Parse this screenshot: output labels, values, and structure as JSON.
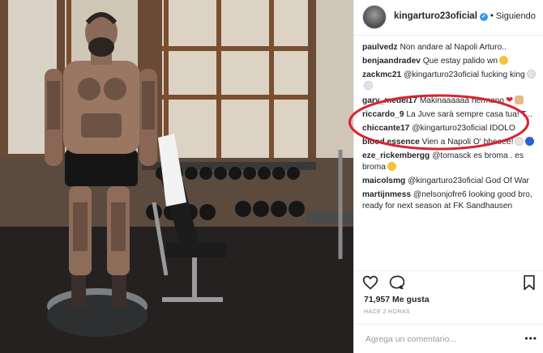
{
  "post": {
    "username": "kingarturo23oficial",
    "separator": "•",
    "follow_state": "Siguiendo",
    "likes": "71,957 Me gusta",
    "time_ago": "HACE 2 HORAS",
    "comment_placeholder": "Agrega un comentario...",
    "more_label": "•••"
  },
  "comments": [
    {
      "user": "paulvedz",
      "text": "Non andare al Napoli Arturo..",
      "emoji": []
    },
    {
      "user": "benjaandradev",
      "text": "Que estay palido wn",
      "emoji": [
        "laugh"
      ]
    },
    {
      "user": "zackmc21",
      "text": "@kingarturo23oficial fucking king",
      "emoji": [
        "white",
        "white"
      ]
    },
    {
      "user": "gary_medel17",
      "text": "Makinaaaaaa hermano",
      "emoji": [
        "heart",
        "muscle"
      ]
    },
    {
      "user": "riccardo_9",
      "text": "La Juve sarà sempre casa tua! T...",
      "emoji": []
    },
    {
      "user": "chiccante17",
      "text": "@kingarturo23oficial IDOLO",
      "emoji": []
    },
    {
      "user": "blood.essence",
      "text": "Vien a Napoli O' bbeeee!",
      "emoji": [
        "white",
        "blue"
      ]
    },
    {
      "user": "eze_rickembergg",
      "text": "@tomasck es broma . es broma",
      "emoji": [
        "laugh"
      ]
    },
    {
      "user": "maicolsmg",
      "text": "@kingarturo23oficial God Of War",
      "emoji": []
    },
    {
      "user": "martijnmess",
      "text": "@nelsonjofre6 looking good bro, ready for next season at FK Sandhausen",
      "emoji": []
    }
  ],
  "colors": {
    "verified": "#3897f0",
    "highlight": "#d9232f",
    "text": "#262626",
    "muted": "#999999"
  },
  "icons": [
    "heart-icon",
    "comment-icon",
    "bookmark-icon",
    "verified-badge-icon"
  ]
}
